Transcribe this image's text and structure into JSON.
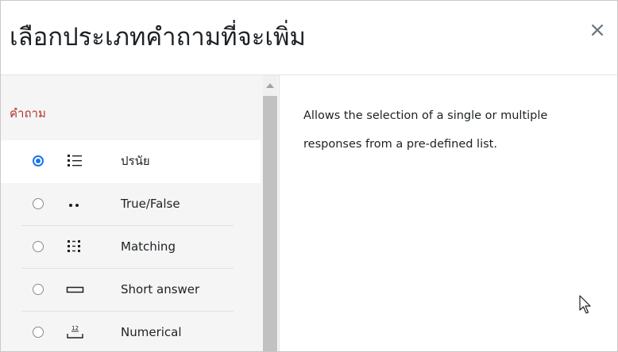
{
  "dialog": {
    "title": "เลือกประเภทคำถามที่จะเพิ่ม",
    "close_icon": "close-icon",
    "close_glyph": "×"
  },
  "options_panel": {
    "section_label": "คำถาม",
    "selected_index": 0,
    "items": [
      {
        "label": "ปรนัย",
        "icon": "multichoice-list-icon",
        "selected": true
      },
      {
        "label": "True/False",
        "icon": "truefalse-dots-icon",
        "selected": false
      },
      {
        "label": "Matching",
        "icon": "matching-list-icon",
        "selected": false
      },
      {
        "label": "Short answer",
        "icon": "short-answer-box-icon",
        "selected": false
      },
      {
        "label": "Numerical",
        "icon": "numerical-icon",
        "selected": false
      }
    ]
  },
  "description": {
    "text": "Allows the selection of a single or multiple responses from a pre-defined list."
  },
  "colors": {
    "section_label": "#b5322a",
    "radio_selected": "#1a73e8",
    "panel_bg": "#f5f5f5",
    "text": "#1d2125"
  }
}
